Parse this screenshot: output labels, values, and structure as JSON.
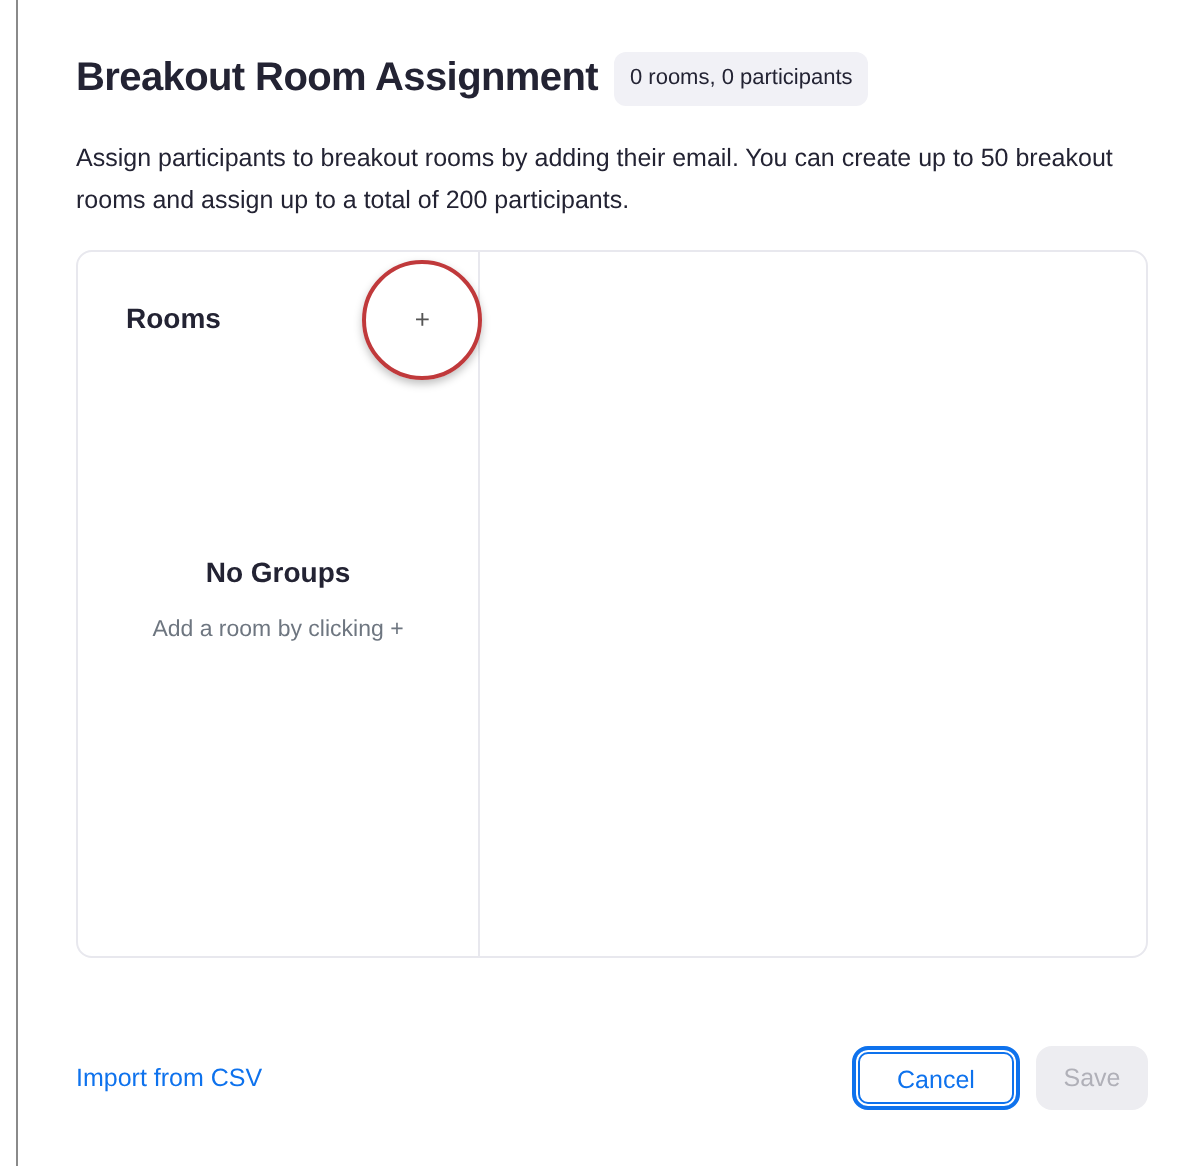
{
  "dialog": {
    "title": "Breakout Room Assignment",
    "count_badge": "0 rooms, 0 participants",
    "description": "Assign participants to breakout rooms by adding their email. You can create up to 50 breakout rooms and assign up to a total of 200 participants."
  },
  "rooms_panel": {
    "heading": "Rooms",
    "add_button": {
      "label": "+",
      "highlighted": true
    },
    "empty_state": {
      "title": "No Groups",
      "hint": "Add a room by clicking +"
    }
  },
  "footer": {
    "import_link": "Import from CSV",
    "buttons": [
      {
        "label": "Cancel",
        "focused": true,
        "disabled": false
      },
      {
        "label": "Save",
        "focused": false,
        "disabled": true
      }
    ]
  }
}
